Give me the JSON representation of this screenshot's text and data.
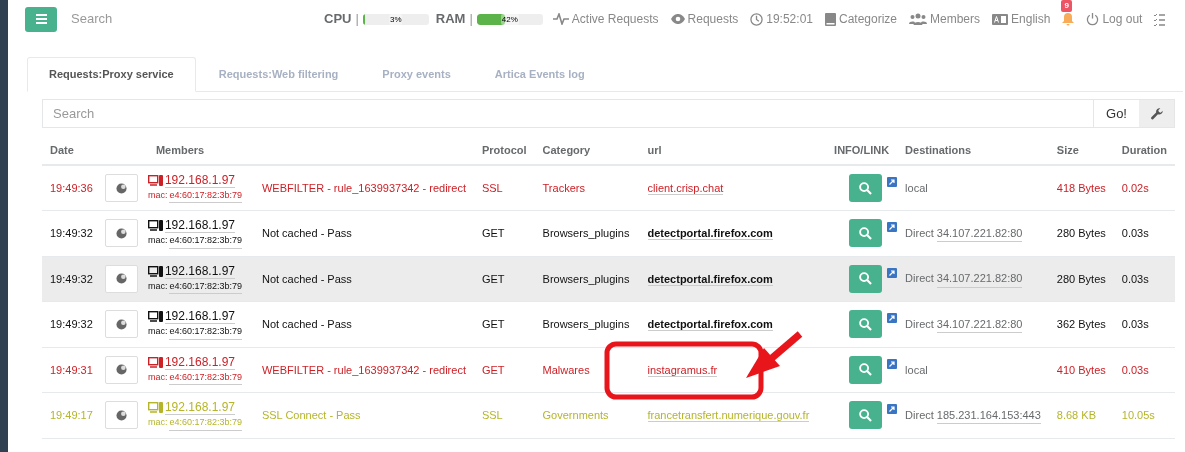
{
  "topbar": {
    "search_placeholder": "Search",
    "meters": [
      {
        "label": "CPU",
        "separator": "|",
        "level": 0.03,
        "reading": "3%"
      },
      {
        "label": "RAM",
        "separator": "|",
        "level": 0.42,
        "reading": "42%"
      }
    ],
    "nav": [
      {
        "kind": "pulse",
        "label": "Active Requests"
      },
      {
        "kind": "eye",
        "label": "Requests"
      },
      {
        "kind": "clock",
        "label": "19:52:01"
      },
      {
        "kind": "book",
        "label": "Categorize"
      },
      {
        "kind": "users",
        "label": "Members"
      },
      {
        "kind": "language",
        "label": "English"
      },
      {
        "kind": "bell",
        "badge": "9"
      },
      {
        "kind": "power",
        "label": "Log out"
      },
      {
        "kind": "tasks"
      }
    ]
  },
  "tabs": [
    {
      "label": "Requests:Proxy service",
      "selected": true
    },
    {
      "label": "Requests:Web filtering",
      "selected": false
    },
    {
      "label": "Proxy events",
      "selected": false
    },
    {
      "label": "Artica Events log",
      "selected": false
    }
  ],
  "search": {
    "placeholder": "Search",
    "button": "Go!"
  },
  "table": {
    "columns": [
      "Date",
      "Members",
      "Protocol",
      "Category",
      "url",
      "INFO/LINK",
      "Destinations",
      "Size",
      "Duration"
    ],
    "rows": [
      {
        "kind": "blocked",
        "hover": false,
        "date": "19:49:36",
        "ip": "192.168.1.97",
        "mac_label": "mac:",
        "mac": "e4:60:17:82:3b:79",
        "action": "WEBFILTER - rule_1639937342 - redirect",
        "protocol": "SSL",
        "category": "Trackers",
        "url": "client.crisp.chat",
        "destination": "local",
        "size": "418 Bytes",
        "duration": "0.02s"
      },
      {
        "kind": "pass",
        "hover": false,
        "date": "19:49:32",
        "ip": "192.168.1.97",
        "mac_label": "mac:",
        "mac": "e4:60:17:82:3b:79",
        "action": "Not cached - Pass",
        "protocol": "GET",
        "category": "Browsers_plugins",
        "url": "detectportal.firefox.com",
        "destination": "Direct",
        "destination_addr": "34.107.221.82:80",
        "size": "280 Bytes",
        "duration": "0.03s"
      },
      {
        "kind": "pass",
        "hover": true,
        "date": "19:49:32",
        "ip": "192.168.1.97",
        "mac_label": "mac:",
        "mac": "e4:60:17:82:3b:79",
        "action": "Not cached - Pass",
        "protocol": "GET",
        "category": "Browsers_plugins",
        "url": "detectportal.firefox.com",
        "destination": "Direct",
        "destination_addr": "34.107.221.82:80",
        "size": "280 Bytes",
        "duration": "0.03s"
      },
      {
        "kind": "pass",
        "hover": false,
        "date": "19:49:32",
        "ip": "192.168.1.97",
        "mac_label": "mac:",
        "mac": "e4:60:17:82:3b:79",
        "action": "Not cached - Pass",
        "protocol": "GET",
        "category": "Browsers_plugins",
        "url": "detectportal.firefox.com",
        "destination": "Direct",
        "destination_addr": "34.107.221.82:80",
        "size": "362 Bytes",
        "duration": "0.03s"
      },
      {
        "kind": "blocked",
        "hover": false,
        "date": "19:49:31",
        "ip": "192.168.1.97",
        "mac_label": "mac:",
        "mac": "e4:60:17:82:3b:79",
        "action": "WEBFILTER - rule_1639937342 - redirect",
        "protocol": "GET",
        "category": "Malwares",
        "url": "instagramus.fr",
        "destination": "local",
        "size": "410 Bytes",
        "duration": "0.03s"
      },
      {
        "kind": "connect",
        "hover": false,
        "date": "19:49:17",
        "ip": "192.168.1.97",
        "mac_label": "mac:",
        "mac": "e4:60:17:82:3b:79",
        "action": "SSL Connect - Pass",
        "protocol": "SSL",
        "category": "Governments",
        "url": "francetransfert.numerique.gouv.fr",
        "destination": "Direct",
        "destination_addr": "185.231.164.153:443",
        "size": "8.68 KB",
        "duration": "10.05s"
      }
    ]
  }
}
